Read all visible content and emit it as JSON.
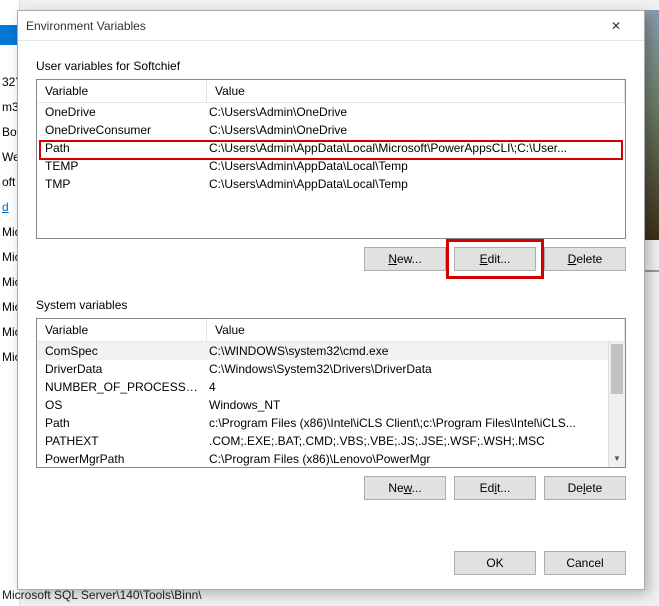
{
  "titlebar": {
    "title": "Environment Variables",
    "close_icon": "✕"
  },
  "user_section": {
    "label": "User variables for Softchief",
    "headers": {
      "variable": "Variable",
      "value": "Value"
    },
    "rows": [
      {
        "variable": "OneDrive",
        "value": "C:\\Users\\Admin\\OneDrive"
      },
      {
        "variable": "OneDriveConsumer",
        "value": "C:\\Users\\Admin\\OneDrive"
      },
      {
        "variable": "Path",
        "value": "C:\\Users\\Admin\\AppData\\Local\\Microsoft\\PowerAppsCLI\\;C:\\User..."
      },
      {
        "variable": "TEMP",
        "value": "C:\\Users\\Admin\\AppData\\Local\\Temp"
      },
      {
        "variable": "TMP",
        "value": "C:\\Users\\Admin\\AppData\\Local\\Temp"
      }
    ],
    "buttons": {
      "new": "New...",
      "edit": "Edit...",
      "delete": "Delete"
    },
    "mnemonics": {
      "new": "N",
      "edit": "E",
      "delete": "D"
    }
  },
  "system_section": {
    "label": "System variables",
    "headers": {
      "variable": "Variable",
      "value": "Value"
    },
    "rows": [
      {
        "variable": "ComSpec",
        "value": "C:\\WINDOWS\\system32\\cmd.exe"
      },
      {
        "variable": "DriverData",
        "value": "C:\\Windows\\System32\\Drivers\\DriverData"
      },
      {
        "variable": "NUMBER_OF_PROCESSORS",
        "value": "4"
      },
      {
        "variable": "OS",
        "value": "Windows_NT"
      },
      {
        "variable": "Path",
        "value": "c:\\Program Files (x86)\\Intel\\iCLS Client\\;c:\\Program Files\\Intel\\iCLS..."
      },
      {
        "variable": "PATHEXT",
        "value": ".COM;.EXE;.BAT;.CMD;.VBS;.VBE;.JS;.JSE;.WSF;.WSH;.MSC"
      },
      {
        "variable": "PowerMgrPath",
        "value": "C:\\Program Files (x86)\\Lenovo\\PowerMgr"
      }
    ],
    "buttons": {
      "new": "New...",
      "edit": "Edit...",
      "delete": "Delete"
    },
    "mnemonics": {
      "new": "w",
      "edit": "i",
      "delete": "l"
    }
  },
  "dialog_buttons": {
    "ok": "OK",
    "cancel": "Cancel"
  },
  "callouts": {
    "highlighted_row_index": 2,
    "highlighted_button": "edit"
  },
  "bg_bottom_text": "Microsoft SQL Server\\140\\Tools\\Binn\\"
}
